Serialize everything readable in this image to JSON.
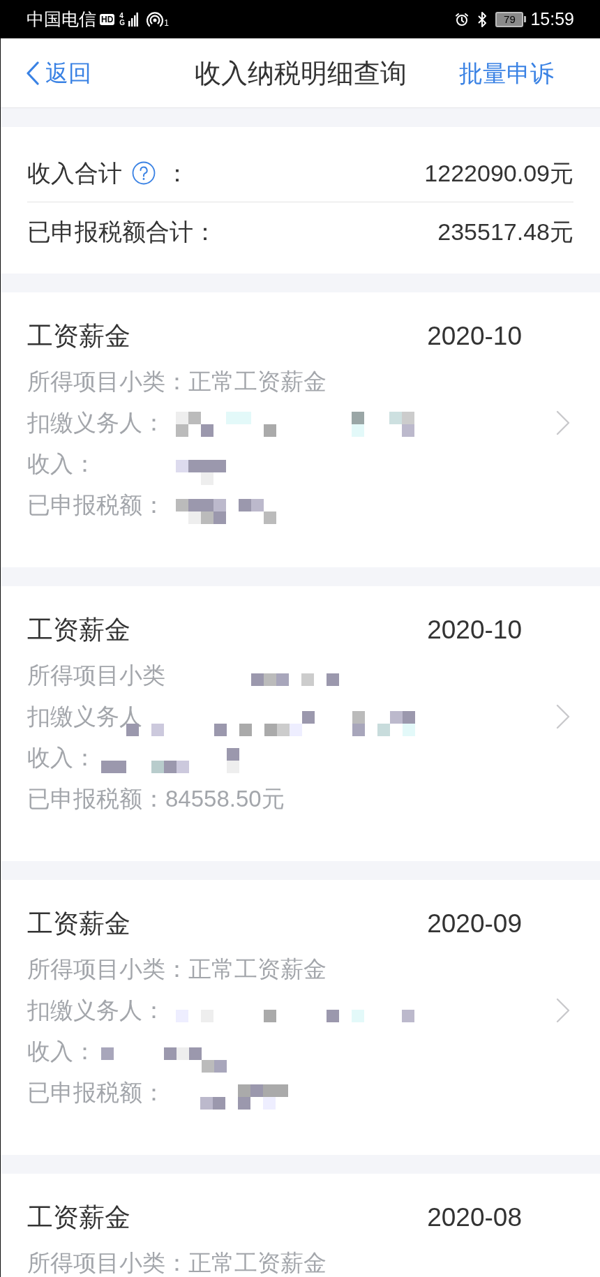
{
  "status_bar": {
    "carrier": "中国电信",
    "hd_badge": "HD",
    "network": "4G",
    "hotspot_count": "1",
    "battery": "79",
    "time": "15:59"
  },
  "nav_bar": {
    "back": "返回",
    "title": "收入纳税明细查询",
    "action": "批量申诉"
  },
  "summary": [
    {
      "label": "收入合计",
      "help": true,
      "colon": "：",
      "value": "1222090.09元"
    },
    {
      "label": "已申报税额合计：",
      "help": false,
      "value": "235517.48元"
    }
  ],
  "records": [
    {
      "category": "工资薪金",
      "period": "2020-10",
      "fields": [
        {
          "label": "所得项目小类：",
          "value": "正常工资薪金",
          "kind": "text"
        },
        {
          "label": "扣缴义务人：",
          "kind": "redacted"
        },
        {
          "label": "收入：",
          "kind": "redacted"
        },
        {
          "label": "已申报税额：",
          "kind": "redacted"
        }
      ]
    },
    {
      "category": "工资薪金",
      "period": "2020-10",
      "fields": [
        {
          "label": "所得项目小类",
          "kind": "redacted"
        },
        {
          "label": "扣缴义务人",
          "kind": "redacted"
        },
        {
          "label": "收入：",
          "kind": "redacted"
        },
        {
          "label": "已申报税额：",
          "value": "84558.50元",
          "kind": "text"
        }
      ]
    },
    {
      "category": "工资薪金",
      "period": "2020-09",
      "fields": [
        {
          "label": "所得项目小类：",
          "value": "正常工资薪金",
          "kind": "text"
        },
        {
          "label": "扣缴义务人：",
          "kind": "redacted"
        },
        {
          "label": "收入：",
          "kind": "redacted"
        },
        {
          "label": "已申报税额：",
          "kind": "redacted"
        }
      ]
    },
    {
      "category": "工资薪金",
      "period": "2020-08",
      "fields": [
        {
          "label": "所得项目小类：",
          "value": "正常工资薪金",
          "kind": "text"
        }
      ]
    }
  ]
}
